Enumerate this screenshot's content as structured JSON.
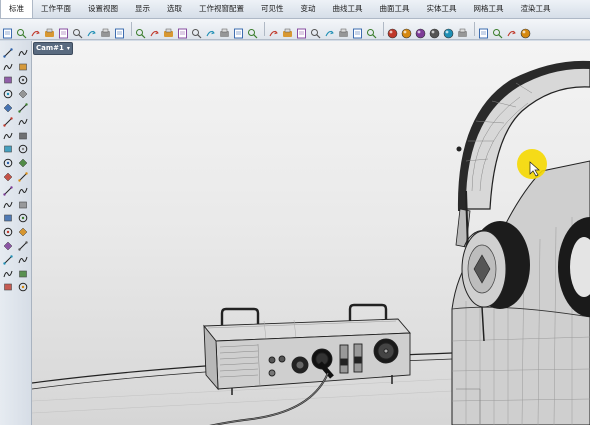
{
  "tabs": [
    {
      "label": "标准"
    },
    {
      "label": "工作平面"
    },
    {
      "label": "设置视图"
    },
    {
      "label": "显示"
    },
    {
      "label": "选取"
    },
    {
      "label": "工作视窗配置"
    },
    {
      "label": "可见性"
    },
    {
      "label": "变动"
    },
    {
      "label": "曲线工具"
    },
    {
      "label": "曲面工具"
    },
    {
      "label": "实体工具"
    },
    {
      "label": "网格工具"
    },
    {
      "label": "渲染工具"
    }
  ],
  "active_tab": "标准",
  "viewport": {
    "label": "Cam#1",
    "menu_arrow": "▾"
  },
  "colors": {
    "accent": "#5a6b80",
    "cursor_highlight": "#f5d800",
    "viewport_bg": "#eeeeee"
  },
  "toolbar_icons": [
    "new-icon",
    "open-icon",
    "save-icon",
    "print-icon",
    "import-icon",
    "cut-icon",
    "copy-icon",
    "paste-icon",
    "undo-icon",
    "pan-icon",
    "rotate-icon",
    "zoom-icon",
    "zoom-window-icon",
    "zoom-extents-icon",
    "zoom-selected-icon",
    "undo-view-icon",
    "four-viewports-icon",
    "options-icon",
    "car-icon",
    "select-filter-icon",
    "grid-snap-icon",
    "layer-icon",
    "properties-icon",
    "light-icon",
    "lock-icon",
    "material-icon",
    "color-wheel-icon",
    "render-sphere-icon",
    "shaded-sphere-icon",
    "rendered-sphere-icon",
    "blue-sphere-icon",
    "settings-icon",
    "history-icon",
    "group-icon",
    "help-icon",
    "sphere-icon"
  ],
  "sidebar_icons": [
    [
      "point-icon",
      "select-icon"
    ],
    [
      "line-icon",
      "polyline-icon"
    ],
    [
      "curve-icon",
      "freeform-icon"
    ],
    [
      "arc-icon",
      "rectangle-icon"
    ],
    [
      "circle-icon",
      "polygon-icon"
    ],
    [
      "offset-icon",
      "fillet-icon"
    ],
    [
      "surface-icon",
      "extrude-icon"
    ],
    [
      "box-icon",
      "solid-icon"
    ],
    [
      "mesh-icon",
      "boolean-icon"
    ],
    [
      "move-icon",
      "explode-icon"
    ],
    [
      "transform-icon",
      "array-icon"
    ],
    [
      "dimension-icon",
      "text-icon"
    ],
    [
      "trim-icon",
      "split-icon"
    ],
    [
      "analyze-icon",
      "measure-icon"
    ],
    [
      "render-icon",
      "camera-icon"
    ],
    [
      "layout-icon",
      "drafting-icon"
    ],
    [
      "bucket-icon",
      "checkmark-icon"
    ],
    [
      "eraser-icon",
      "paint-icon"
    ]
  ]
}
